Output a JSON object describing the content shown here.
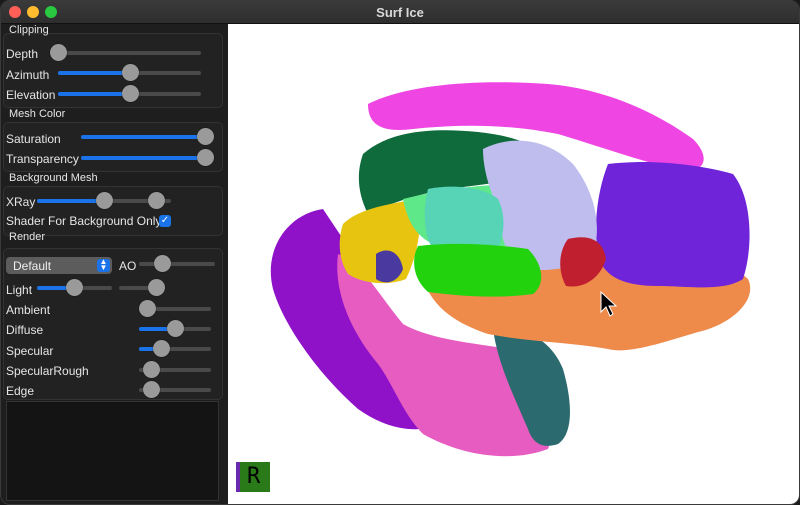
{
  "window": {
    "title": "Surf Ice"
  },
  "clipping": {
    "title": "Clipping",
    "depth": {
      "label": "Depth",
      "value": 0
    },
    "azimuth": {
      "label": "Azimuth",
      "value": 50
    },
    "elevation": {
      "label": "Elevation",
      "value": 50
    }
  },
  "mesh_color": {
    "title": "Mesh Color",
    "saturation": {
      "label": "Saturation",
      "value": 100
    },
    "transparency": {
      "label": "Transparency",
      "value": 100
    }
  },
  "background_mesh": {
    "title": "Background Mesh",
    "xray": {
      "label": "XRay",
      "value": 50,
      "value2": 0
    },
    "shader_bg": {
      "label": "Shader For Background Only",
      "checked": true
    }
  },
  "render": {
    "title": "Render",
    "shader": {
      "selected": "Default"
    },
    "ao": {
      "label": "AO",
      "value": 0
    },
    "light": {
      "label": "Light",
      "value": 50,
      "value2": 0
    },
    "ambient": {
      "label": "Ambient",
      "value": 0
    },
    "diffuse": {
      "label": "Diffuse",
      "value": 50
    },
    "specular": {
      "label": "Specular",
      "value": 30
    },
    "specular_rough": {
      "label": "SpecularRough",
      "value": 0
    },
    "edge": {
      "label": "Edge",
      "value": 0
    }
  },
  "viewport": {
    "orientation_label": "R"
  },
  "colors": {
    "accent": "#1a73e8",
    "view_bg": "#ffffff"
  }
}
